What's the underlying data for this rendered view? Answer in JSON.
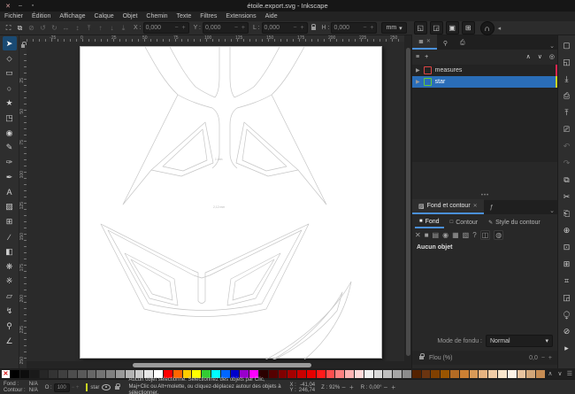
{
  "window": {
    "title": "étoile.export.svg - Inkscape",
    "controls": [
      {
        "n": "close-button",
        "g": "✕"
      },
      {
        "n": "minimize-button",
        "g": "–"
      },
      {
        "n": "maximize-button",
        "g": "▫"
      }
    ]
  },
  "menu": {
    "items": [
      "Fichier",
      "Édition",
      "Affichage",
      "Calque",
      "Objet",
      "Chemin",
      "Texte",
      "Filtres",
      "Extensions",
      "Aide"
    ]
  },
  "toolbar": {
    "icons": [
      {
        "n": "select-all-button",
        "g": "⛶"
      },
      {
        "n": "select-all-layers-button",
        "g": "⧉"
      },
      {
        "n": "deselect-button",
        "g": "⊘",
        "dim": true
      },
      {
        "n": "rotate-ccw-button",
        "g": "↺",
        "dim": true
      },
      {
        "n": "rotate-cw-button",
        "g": "↻",
        "dim": true
      },
      {
        "n": "flip-horizontal-button",
        "g": "↔",
        "dim": true
      },
      {
        "n": "flip-vertical-button",
        "g": "↕",
        "dim": true
      },
      {
        "n": "raise-to-top-button",
        "g": "⤒",
        "dim": true
      },
      {
        "n": "raise-button",
        "g": "↑",
        "dim": true
      },
      {
        "n": "lower-button",
        "g": "↓",
        "dim": true
      },
      {
        "n": "lower-to-bottom-button",
        "g": "⤓",
        "dim": true
      }
    ],
    "x_label": "X :",
    "x_value": "0,000",
    "y_label": "Y :",
    "y_value": "0,000",
    "w_label": "L :",
    "w_value": "0,000",
    "h_label": "H :",
    "h_value": "0,000",
    "spinner": "− +",
    "units": "mm",
    "unit_arrow": "▾",
    "toggles": [
      {
        "n": "scale-stroke-toggle",
        "g": "◱"
      },
      {
        "n": "scale-corners-toggle",
        "g": "◲"
      },
      {
        "n": "move-gradients-toggle",
        "g": "▣"
      },
      {
        "n": "move-patterns-toggle",
        "g": "⊞"
      }
    ],
    "snap_glyph": "∩",
    "collapse_arrow": "◂"
  },
  "tools": [
    {
      "n": "tool-selector",
      "g": "➤",
      "sel": true
    },
    {
      "n": "tool-node-editor",
      "g": "⬦"
    },
    {
      "n": "tool-rectangle",
      "g": "▭"
    },
    {
      "n": "tool-ellipse",
      "g": "○"
    },
    {
      "n": "tool-star",
      "g": "★"
    },
    {
      "n": "tool-3dbox",
      "g": "◳"
    },
    {
      "n": "tool-spiral",
      "g": "◉"
    },
    {
      "n": "tool-pencil",
      "g": "✎"
    },
    {
      "n": "tool-bezier-pen",
      "g": "✑"
    },
    {
      "n": "tool-calligraphy",
      "g": "✒"
    },
    {
      "n": "tool-text",
      "g": "A"
    },
    {
      "n": "tool-gradient",
      "g": "▨"
    },
    {
      "n": "tool-mesh",
      "g": "⊞"
    },
    {
      "n": "tool-dropper",
      "g": "∕"
    },
    {
      "n": "tool-paint-bucket",
      "g": "◧"
    },
    {
      "n": "tool-tweak",
      "g": "❋"
    },
    {
      "n": "tool-spray",
      "g": "※"
    },
    {
      "n": "tool-eraser",
      "g": "▱"
    },
    {
      "n": "tool-connector",
      "g": "↯"
    },
    {
      "n": "tool-zoom",
      "g": "⚲"
    },
    {
      "n": "tool-measure",
      "g": "∠"
    }
  ],
  "rulers": {
    "top_labels": [
      "-25",
      "0",
      "25",
      "50",
      "75",
      "100",
      "125",
      "150",
      "175",
      "200",
      "225",
      "250"
    ],
    "left_labels": [
      "0",
      "25",
      "50",
      "75",
      "100",
      "125",
      "150",
      "175",
      "200",
      "225",
      "250"
    ]
  },
  "canvas": {
    "measure_label_top": "1 mm",
    "measure_label_bottom": "2,12 mm"
  },
  "objects_panel": {
    "tab_icon": "≣",
    "tab_close": "✕",
    "tab2_icon": "⚲",
    "tab3_icon": "⎙",
    "chevron": "⌄",
    "toolbar_left": [
      {
        "n": "new-layer-button",
        "g": "≡"
      },
      {
        "n": "add-object-button",
        "g": "+"
      }
    ],
    "toolbar_right": [
      {
        "n": "move-up-button",
        "g": "∧"
      },
      {
        "n": "move-down-button",
        "g": "∨"
      },
      {
        "n": "highlight-button",
        "g": "◎"
      }
    ],
    "layers": [
      {
        "name": "measures",
        "tag": "#e0254f",
        "icon": "#d44",
        "expander": "▶"
      },
      {
        "name": "star",
        "tag": "#c9d421",
        "icon": "#6c3",
        "expander": "▶"
      }
    ],
    "grip": "•••"
  },
  "fill_stroke": {
    "tab_icon": "▨",
    "tab_title": "Fond et contour",
    "tab_close": "✕",
    "tab2_icon": "ƒ",
    "chevron": "⌄",
    "subtabs": [
      {
        "n": "tab-fill",
        "icon": "■",
        "label": "Fond",
        "active": true
      },
      {
        "n": "tab-stroke",
        "icon": "□",
        "label": "Contour"
      },
      {
        "n": "tab-stroke-style",
        "icon": "✎",
        "label": "Style du contour"
      }
    ],
    "paint_buttons": [
      {
        "n": "paint-none-button",
        "g": "✕"
      },
      {
        "n": "paint-flat-button",
        "g": "■"
      },
      {
        "n": "paint-linear-gradient-button",
        "g": "▤"
      },
      {
        "n": "paint-radial-gradient-button",
        "g": "◉"
      },
      {
        "n": "paint-pattern-button",
        "g": "▦"
      },
      {
        "n": "paint-swatch-button",
        "g": "▧"
      },
      {
        "n": "paint-unknown-button",
        "g": "?"
      },
      {
        "n": "paint-mesh-button",
        "g": "◫",
        "boxed": true
      },
      {
        "n": "paint-conical-button",
        "g": "◍",
        "boxed": true
      }
    ],
    "no_object": "Aucun objet",
    "blend_label": "Mode de fondu :",
    "blend_value": "Normal",
    "blend_arrow": "▾",
    "blur_label": "Flou (%)",
    "blur_value": "0,0",
    "spinner": "− +"
  },
  "right_strip": [
    {
      "n": "new-document-button",
      "g": "▢"
    },
    {
      "n": "open-document-button",
      "g": "◱"
    },
    {
      "n": "import-button",
      "g": "⤓"
    },
    {
      "n": "print-button",
      "g": "⎙"
    },
    {
      "n": "export-button",
      "g": "⤒"
    },
    {
      "n": "document-properties-button",
      "g": "⎚"
    },
    {
      "n": "undo-button",
      "g": "↶",
      "dim": true
    },
    {
      "n": "redo-button",
      "g": "↷",
      "dim": true
    },
    {
      "n": "copy-button",
      "g": "⧉"
    },
    {
      "n": "cut-button",
      "g": "✂"
    },
    {
      "n": "paste-button",
      "g": "⎗"
    },
    {
      "n": "zoom-selection-button",
      "g": "⊕"
    },
    {
      "n": "zoom-drawing-button",
      "g": "⊡"
    },
    {
      "n": "zoom-page-button",
      "g": "⊞"
    },
    {
      "n": "zoom-center-button",
      "g": "⌗"
    },
    {
      "n": "duplicate-button",
      "g": "◲"
    },
    {
      "n": "clone-button",
      "g": "⧬"
    },
    {
      "n": "unlink-clone-button",
      "g": "⊘"
    },
    {
      "n": "expand-strip-button",
      "g": "▸"
    }
  ],
  "palette": {
    "colors": [
      "none",
      "#000000",
      "#0d0d0d",
      "#1a1a1a",
      "#262626",
      "#333333",
      "#404040",
      "#4d4d4d",
      "#595959",
      "#666666",
      "#737373",
      "#808080",
      "#999999",
      "#b3b3b3",
      "#cccccc",
      "#e6e6e6",
      "#ffffff",
      "#ff0000",
      "#ff6600",
      "#ffcc00",
      "#ffff00",
      "#33cc33",
      "#00ffff",
      "#0066ff",
      "#0000cc",
      "#9900cc",
      "#ff00ff",
      "#2b0000",
      "#550000",
      "#800000",
      "#a40000",
      "#c80000",
      "#e50000",
      "#ff1a1a",
      "#ff4d4d",
      "#ff8080",
      "#ffb3b3",
      "#ffd9d9",
      "#f0f0f0",
      "#d9d9d9",
      "#bfbfbf",
      "#a6a6a6",
      "#8c8c8c",
      "#552200",
      "#6b3410",
      "#804000",
      "#995500",
      "#b36b24",
      "#cc8033",
      "#d99a57",
      "#e6b380",
      "#f2cda6",
      "#f9e6cc",
      "#fdf3e6",
      "#e8c39e",
      "#d2a679",
      "#c68c53"
    ],
    "scroll_up": "∧",
    "scroll_down": "∨",
    "menu": "☰"
  },
  "statusbar": {
    "fill_label": "Fond :",
    "fill_value": "N/A",
    "stroke_label": "Contour :",
    "stroke_value": "N/A",
    "opacity_label": "O :",
    "opacity_value": "100",
    "spinner": "− +",
    "layer_name": "star",
    "message": "Aucun objet sélectionné. Sélectionnez des objets par Clic, Maj+Clic ou Alt+molette, ou cliquez-déplacez autour des objets à sélectionner.",
    "x_label": "X :",
    "x_value": "-41,04",
    "y_label": "Y :",
    "y_value": "246,74",
    "zoom_label": "Z :",
    "zoom_value": "92%",
    "rotation_label": "R :",
    "rotation_value": "0,00°"
  }
}
